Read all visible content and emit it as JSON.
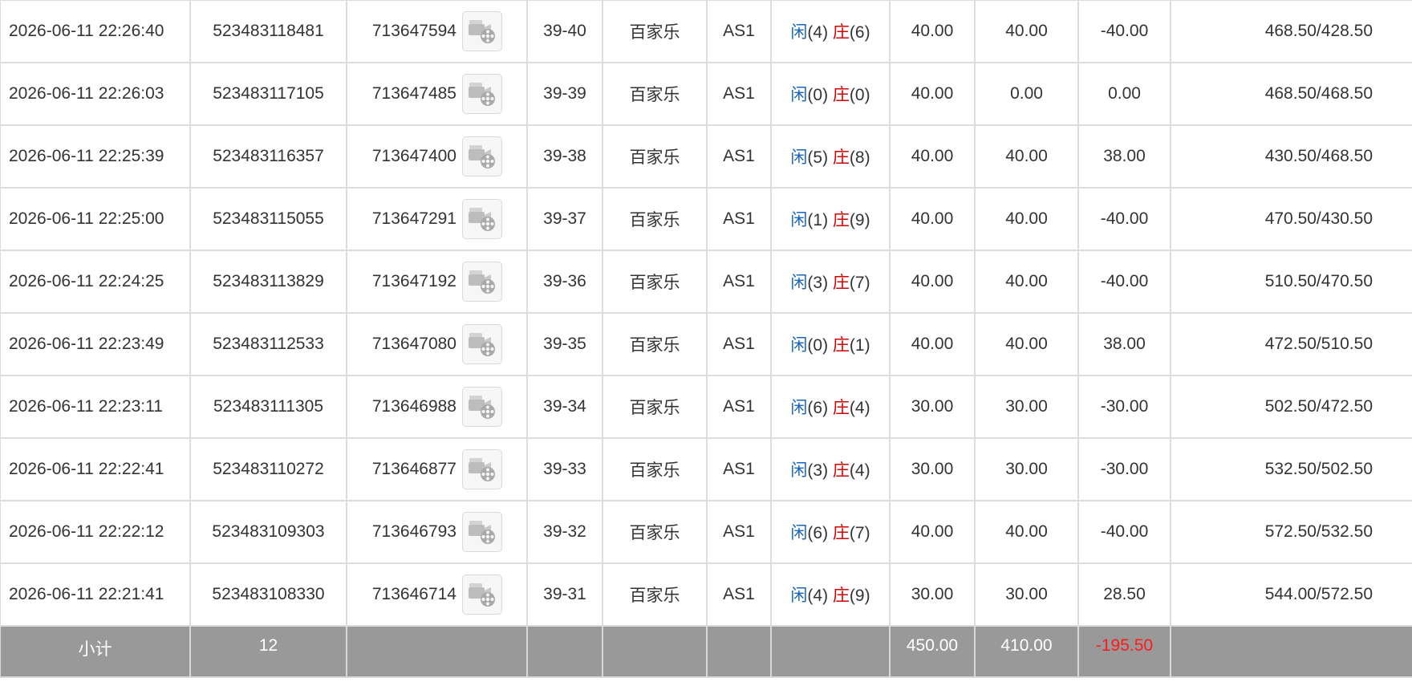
{
  "columns": [
    "time",
    "bet_id",
    "game_id",
    "table_round",
    "game_type",
    "table",
    "result",
    "bet_amount",
    "valid_bet",
    "win_loss",
    "balance"
  ],
  "rows": [
    {
      "time": "2026-06-11 22:26:40",
      "bet_id": "523483118481",
      "game_id": "713647594",
      "round": "39-40",
      "game": "百家乐",
      "table": "AS1",
      "player_label": "闲",
      "player_score": "(4)",
      "banker_label": "庄",
      "banker_score": "(6)",
      "bet": "40.00",
      "valid": "40.00",
      "winloss": "-40.00",
      "balance": "468.50/428.50"
    },
    {
      "time": "2026-06-11 22:26:03",
      "bet_id": "523483117105",
      "game_id": "713647485",
      "round": "39-39",
      "game": "百家乐",
      "table": "AS1",
      "player_label": "闲",
      "player_score": "(0)",
      "banker_label": "庄",
      "banker_score": "(0)",
      "bet": "40.00",
      "valid": "0.00",
      "winloss": "0.00",
      "balance": "468.50/468.50"
    },
    {
      "time": "2026-06-11 22:25:39",
      "bet_id": "523483116357",
      "game_id": "713647400",
      "round": "39-38",
      "game": "百家乐",
      "table": "AS1",
      "player_label": "闲",
      "player_score": "(5)",
      "banker_label": "庄",
      "banker_score": "(8)",
      "bet": "40.00",
      "valid": "40.00",
      "winloss": "38.00",
      "balance": "430.50/468.50"
    },
    {
      "time": "2026-06-11 22:25:00",
      "bet_id": "523483115055",
      "game_id": "713647291",
      "round": "39-37",
      "game": "百家乐",
      "table": "AS1",
      "player_label": "闲",
      "player_score": "(1)",
      "banker_label": "庄",
      "banker_score": "(9)",
      "bet": "40.00",
      "valid": "40.00",
      "winloss": "-40.00",
      "balance": "470.50/430.50"
    },
    {
      "time": "2026-06-11 22:24:25",
      "bet_id": "523483113829",
      "game_id": "713647192",
      "round": "39-36",
      "game": "百家乐",
      "table": "AS1",
      "player_label": "闲",
      "player_score": "(3)",
      "banker_label": "庄",
      "banker_score": "(7)",
      "bet": "40.00",
      "valid": "40.00",
      "winloss": "-40.00",
      "balance": "510.50/470.50"
    },
    {
      "time": "2026-06-11 22:23:49",
      "bet_id": "523483112533",
      "game_id": "713647080",
      "round": "39-35",
      "game": "百家乐",
      "table": "AS1",
      "player_label": "闲",
      "player_score": "(0)",
      "banker_label": "庄",
      "banker_score": "(1)",
      "bet": "40.00",
      "valid": "40.00",
      "winloss": "38.00",
      "balance": "472.50/510.50"
    },
    {
      "time": "2026-06-11 22:23:11",
      "bet_id": "523483111305",
      "game_id": "713646988",
      "round": "39-34",
      "game": "百家乐",
      "table": "AS1",
      "player_label": "闲",
      "player_score": "(6)",
      "banker_label": "庄",
      "banker_score": "(4)",
      "bet": "30.00",
      "valid": "30.00",
      "winloss": "-30.00",
      "balance": "502.50/472.50"
    },
    {
      "time": "2026-06-11 22:22:41",
      "bet_id": "523483110272",
      "game_id": "713646877",
      "round": "39-33",
      "game": "百家乐",
      "table": "AS1",
      "player_label": "闲",
      "player_score": "(3)",
      "banker_label": "庄",
      "banker_score": "(4)",
      "bet": "30.00",
      "valid": "30.00",
      "winloss": "-30.00",
      "balance": "532.50/502.50"
    },
    {
      "time": "2026-06-11 22:22:12",
      "bet_id": "523483109303",
      "game_id": "713646793",
      "round": "39-32",
      "game": "百家乐",
      "table": "AS1",
      "player_label": "闲",
      "player_score": "(6)",
      "banker_label": "庄",
      "banker_score": "(7)",
      "bet": "40.00",
      "valid": "40.00",
      "winloss": "-40.00",
      "balance": "572.50/532.50"
    },
    {
      "time": "2026-06-11 22:21:41",
      "bet_id": "523483108330",
      "game_id": "713646714",
      "round": "39-31",
      "game": "百家乐",
      "table": "AS1",
      "player_label": "闲",
      "player_score": "(4)",
      "banker_label": "庄",
      "banker_score": "(9)",
      "bet": "30.00",
      "valid": "30.00",
      "winloss": "28.50",
      "balance": "544.00/572.50"
    }
  ],
  "subtotal": {
    "label": "小计",
    "count": "12",
    "bet": "450.00",
    "valid": "410.00",
    "winloss": "-195.50"
  },
  "video_icon": "video-replay-icon",
  "colors": {
    "player": "#1565c0",
    "banker": "#d50000",
    "bet_amount": "#1a6fd6",
    "loss": "#e00000",
    "subtotal_bg": "#999999"
  }
}
